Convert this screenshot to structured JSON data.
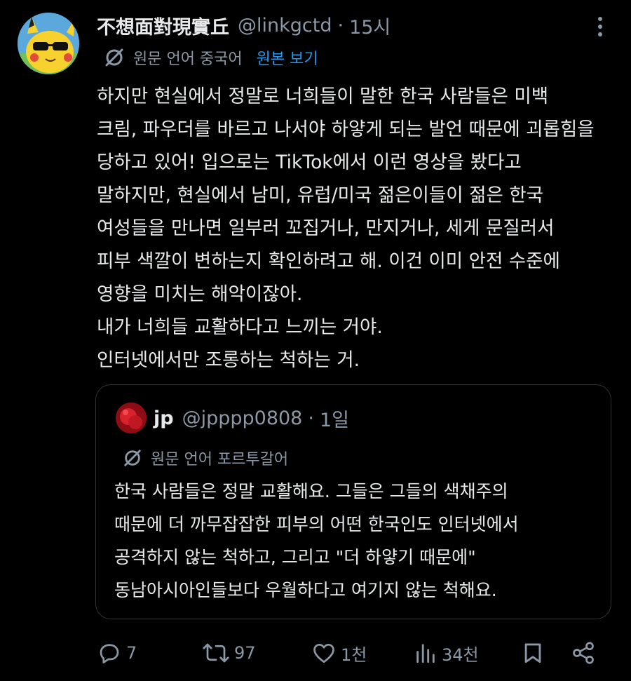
{
  "post": {
    "display_name": "不想面對現實丘",
    "handle": "@linkgctd",
    "separator": "·",
    "time": "15시",
    "translation": {
      "label": "원문 언어 중국어",
      "show_original": "원본 보기"
    },
    "body_lines": [
      "하지만 현실에서 정말로 너희들이 말한 한국 사람들은 미백",
      "크림, 파우더를 바르고 나서야 하얗게 되는 발언 때문에 괴롭힘을",
      "당하고 있어! 입으로는 TikTok에서 이런 영상을 봤다고",
      "말하지만, 현실에서 남미, 유럽/미국 젊은이들이 젊은 한국",
      "여성들을 만나면 일부러 꼬집거나, 만지거나, 세게 문질러서",
      "피부 색깔이 변하는지 확인하려고 해. 이건 이미 안전 수준에",
      "영향을 미치는 해악이잖아.",
      "내가 너희들 교활하다고 느끼는 거야.",
      "인터넷에서만 조롱하는 척하는 거."
    ]
  },
  "quote": {
    "display_name": "jp",
    "handle": "@jpppp0808",
    "separator": "·",
    "time": "1일",
    "translation_label": "원문 언어 포르투갈어",
    "body_lines": [
      "한국 사람들은 정말 교활해요. 그들은 그들의 색채주의",
      "때문에 더 까무잡잡한 피부의 어떤 한국인도 인터넷에서",
      "공격하지 않는 척하고, 그리고 \"더 하얗기 때문에\"",
      "동남아시아인들보다 우월하다고 여기지 않는 척해요."
    ]
  },
  "actions": {
    "reply": {
      "icon": "reply-icon",
      "count": "7"
    },
    "repost": {
      "icon": "repost-icon",
      "count": "97"
    },
    "like": {
      "icon": "heart-icon",
      "count": "1천"
    },
    "views": {
      "icon": "views-icon",
      "count": "34천"
    },
    "bookmark": {
      "icon": "bookmark-icon"
    },
    "share": {
      "icon": "share-icon"
    }
  },
  "colors": {
    "background": "#000000",
    "text_primary": "#e7e9ea",
    "text_secondary": "#8b98a5",
    "accent": "#1d9bf0",
    "border": "#2f3336"
  }
}
